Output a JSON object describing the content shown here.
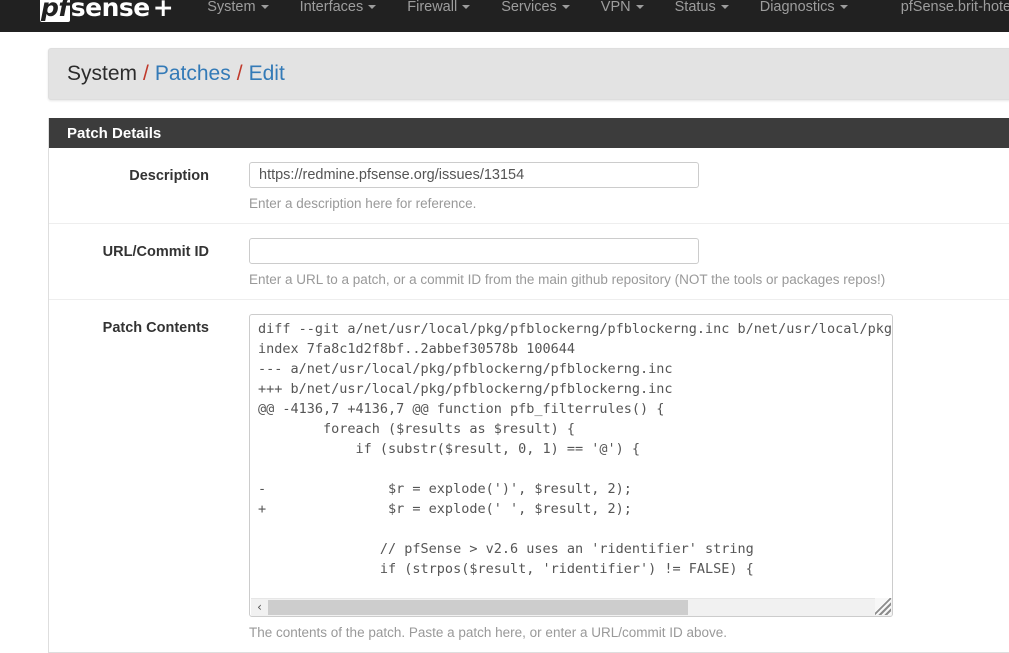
{
  "navbar": {
    "brand_prefix": "pf",
    "brand_main": "sense",
    "brand_plus": "+",
    "menu": [
      {
        "label": "System"
      },
      {
        "label": "Interfaces"
      },
      {
        "label": "Firewall"
      },
      {
        "label": "Services"
      },
      {
        "label": "VPN"
      },
      {
        "label": "Status"
      },
      {
        "label": "Diagnostics"
      }
    ],
    "hostname": "pfSense.brit-hotel-f"
  },
  "breadcrumb": {
    "items": [
      {
        "label": "System",
        "link": false
      },
      {
        "label": "Patches",
        "link": true
      },
      {
        "label": "Edit",
        "link": true
      }
    ],
    "separator": "/"
  },
  "panel": {
    "title": "Patch Details"
  },
  "form": {
    "description": {
      "label": "Description",
      "value": "https://redmine.pfsense.org/issues/13154",
      "placeholder": "",
      "help": "Enter a description here for reference."
    },
    "url_commit_id": {
      "label": "URL/Commit ID",
      "value": "",
      "placeholder": "",
      "help": "Enter a URL to a patch, or a commit ID from the main github repository (NOT the tools or packages repos!)"
    },
    "patch_contents": {
      "label": "Patch Contents",
      "value": "diff --git a/net/usr/local/pkg/pfblockerng/pfblockerng.inc b/net/usr/local/pkg/p\nindex 7fa8c1d2f8bf..2abbef30578b 100644\n--- a/net/usr/local/pkg/pfblockerng/pfblockerng.inc\n+++ b/net/usr/local/pkg/pfblockerng/pfblockerng.inc\n@@ -4136,7 +4136,7 @@ function pfb_filterrules() {\n        foreach ($results as $result) {\n            if (substr($result, 0, 1) == '@') {\n\n-               $r = explode(')', $result, 2);\n+               $r = explode(' ', $result, 2);\n\n               // pfSense > v2.6 uses an 'ridentifier' string\n               if (strpos($result, 'ridentifier') != FALSE) {",
      "help": "The contents of the patch. Paste a patch here, or enter a URL/commit ID above.",
      "scroll_left_arrow": "‹",
      "scroll_right_arrow": "›"
    }
  },
  "colors": {
    "navbar_bg": "#212121",
    "panel_heading_bg": "#3c3c3c",
    "link": "#337ab7",
    "separator": "#c0392b",
    "help_text": "#999999"
  }
}
